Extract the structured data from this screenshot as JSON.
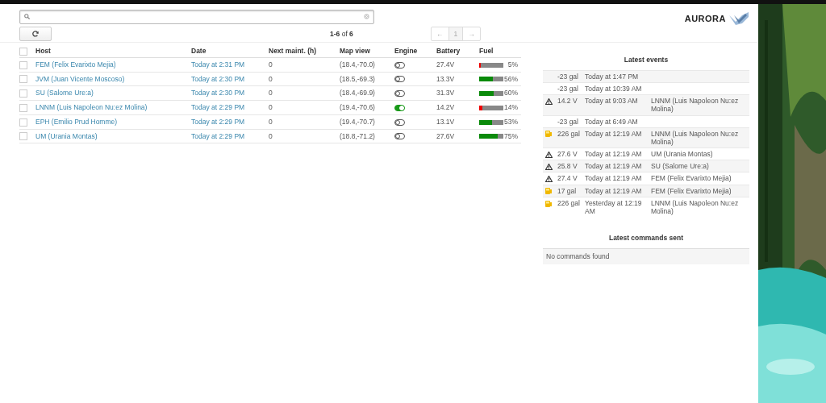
{
  "logo": {
    "text": "AURORA"
  },
  "pagination": {
    "summary": "**1-6** of **6**",
    "prev": "←",
    "page": "1",
    "next": "→"
  },
  "table": {
    "select_all_checked": false,
    "columns": [
      "Host",
      "Date",
      "Next maint. (h)",
      "Map view",
      "Engine",
      "Battery",
      "Fuel"
    ],
    "rows": [
      {
        "checked": false,
        "host": "FEM (Felix Evarixto Mejia)",
        "date": "Today at 2:31 PM",
        "next_maint": "0",
        "map_view": "(18.4,-70.0)",
        "engine_on": false,
        "battery": "27.4V",
        "fuel": {
          "level": 0.05,
          "reading": "5%"
        }
      },
      {
        "checked": false,
        "host": "JVM (Juan Vicente Moscoso)",
        "date": "Today at 2:30 PM",
        "next_maint": "0",
        "map_view": "(18.5,-69.3)",
        "engine_on": false,
        "battery": "13.3V",
        "fuel": {
          "level": 0.56,
          "reading": "56%"
        }
      },
      {
        "checked": false,
        "host": "SU (Salome Ure:a)",
        "date": "Today at 2:30 PM",
        "next_maint": "0",
        "map_view": "(18.4,-69.9)",
        "engine_on": false,
        "battery": "31.3V",
        "fuel": {
          "level": 0.6,
          "reading": "60%"
        }
      },
      {
        "checked": false,
        "host": "LNNM (Luis Napoleon Nu:ez Molina)",
        "date": "Today at 2:29 PM",
        "next_maint": "0",
        "map_view": "(19.4,-70.6)",
        "engine_on": true,
        "battery": "14.2V",
        "fuel": {
          "level": 0.14,
          "reading": "14%"
        }
      },
      {
        "checked": false,
        "host": "EPH (Emilio Prud Homme)",
        "date": "Today at 2:29 PM",
        "next_maint": "0",
        "map_view": "(19.4,-70.7)",
        "engine_on": false,
        "battery": "13.1V",
        "fuel": {
          "level": 0.53,
          "reading": "53%"
        }
      },
      {
        "checked": false,
        "host": "UM (Urania Montas)",
        "date": "Today at 2:29 PM",
        "next_maint": "0",
        "map_view": "(18.8,-71.2)",
        "engine_on": false,
        "battery": "27.6V",
        "fuel": {
          "level": 0.75,
          "reading": "75%"
        }
      }
    ]
  },
  "latest_events": {
    "title": "Latest events",
    "events": [
      {
        "kind": "none",
        "value": "-23 gal",
        "date": "Today at 1:47 PM"
      },
      {
        "kind": "none",
        "value": "-23 gal",
        "date": "Today at 10:39 AM"
      },
      {
        "kind": "warning",
        "value": "14.2 V",
        "date": "Today at 9:03 AM",
        "host": "LNNM (Luis Napoleon Nu:ez Molina)"
      },
      {
        "kind": "none",
        "value": "-23 gal",
        "date": "Today at 6:49 AM"
      },
      {
        "kind": "fuel",
        "value": "226 gal",
        "date": "Today at 12:19 AM",
        "host": "LNNM (Luis Napoleon Nu:ez Molina)"
      },
      {
        "kind": "warning",
        "value": "27.6 V",
        "date": "Today at 12:19 AM",
        "host": "UM (Urania Montas)"
      },
      {
        "kind": "warning",
        "value": "25.8 V",
        "date": "Today at 12:19 AM",
        "host": "SU (Salome Ure:a)"
      },
      {
        "kind": "warning",
        "value": "27.4 V",
        "date": "Today at 12:19 AM",
        "host": "FEM (Felix Evarixto Mejia)"
      },
      {
        "kind": "fuel",
        "value": "17 gal",
        "date": "Today at 12:19 AM",
        "host": "FEM (Felix Evarixto Mejia)"
      },
      {
        "kind": "fuel",
        "value": "226 gal",
        "date": "Yesterday at 12:19 AM",
        "host": "LNNM (Luis Napoleon Nu:ez Molina)"
      }
    ]
  },
  "latest_commands": {
    "title": "Latest commands sent",
    "empty_text": "No commands found"
  }
}
